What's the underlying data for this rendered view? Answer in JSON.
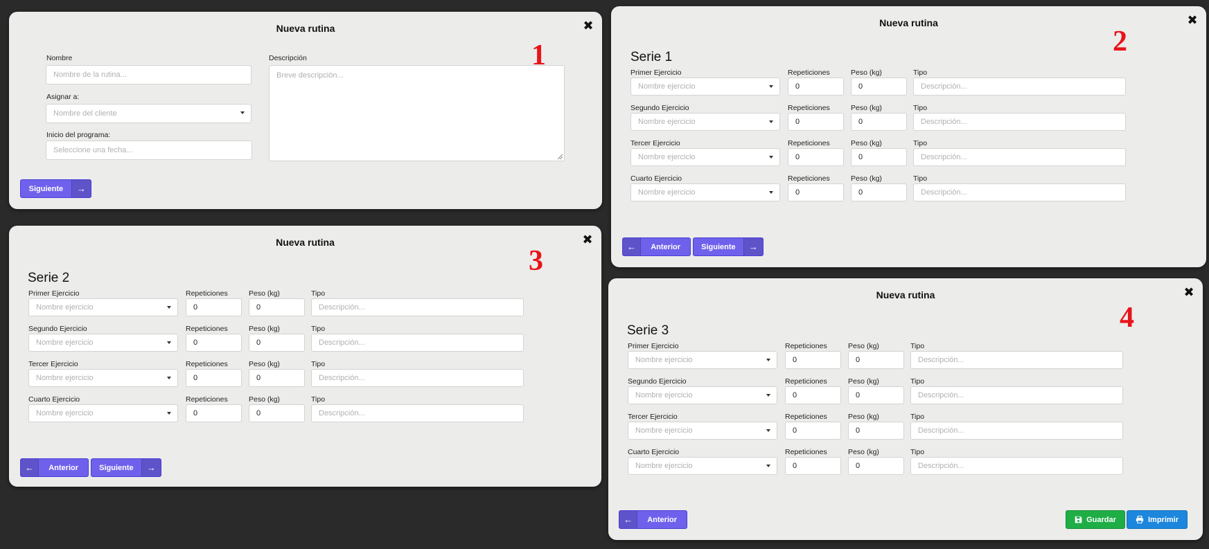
{
  "modal_title": "Nueva rutina",
  "close_icon": "close-icon",
  "step1": {
    "number": "1",
    "nombre_label": "Nombre",
    "nombre_placeholder": "Nombre de la rutina...",
    "asignar_label": "Asignar a:",
    "asignar_placeholder": "Nombre del cliente",
    "inicio_label": "Inicio del programa:",
    "inicio_placeholder": "Seleccione una fecha...",
    "descripcion_label": "Descripción",
    "descripcion_placeholder": "Breve descripción...",
    "next_label": "Siguiente"
  },
  "step2": {
    "number": "2",
    "serie_title": "Serie 1"
  },
  "step3": {
    "number": "3",
    "serie_title": "Serie 2"
  },
  "step4": {
    "number": "4",
    "serie_title": "Serie 3"
  },
  "exercise_rows": [
    {
      "label": "Primer Ejercicio"
    },
    {
      "label": "Segundo Ejercicio"
    },
    {
      "label": "Tercer Ejercicio"
    },
    {
      "label": "Cuarto Ejercicio"
    }
  ],
  "columns": {
    "repeticiones": "Repeticiones",
    "peso": "Peso (kg)",
    "tipo": "Tipo"
  },
  "ejercicio_placeholder": "Nombre ejercicio",
  "reps_value": "0",
  "peso_value": "0",
  "tipo_placeholder": "Descripción...",
  "buttons": {
    "anterior": "Anterior",
    "siguiente": "Siguiente",
    "guardar": "Guardar",
    "imprimir": "Imprimir"
  },
  "colors": {
    "primary": "#6f61ec",
    "success": "#1fae46",
    "info": "#1c87dc",
    "step_number": "#e8141a"
  }
}
